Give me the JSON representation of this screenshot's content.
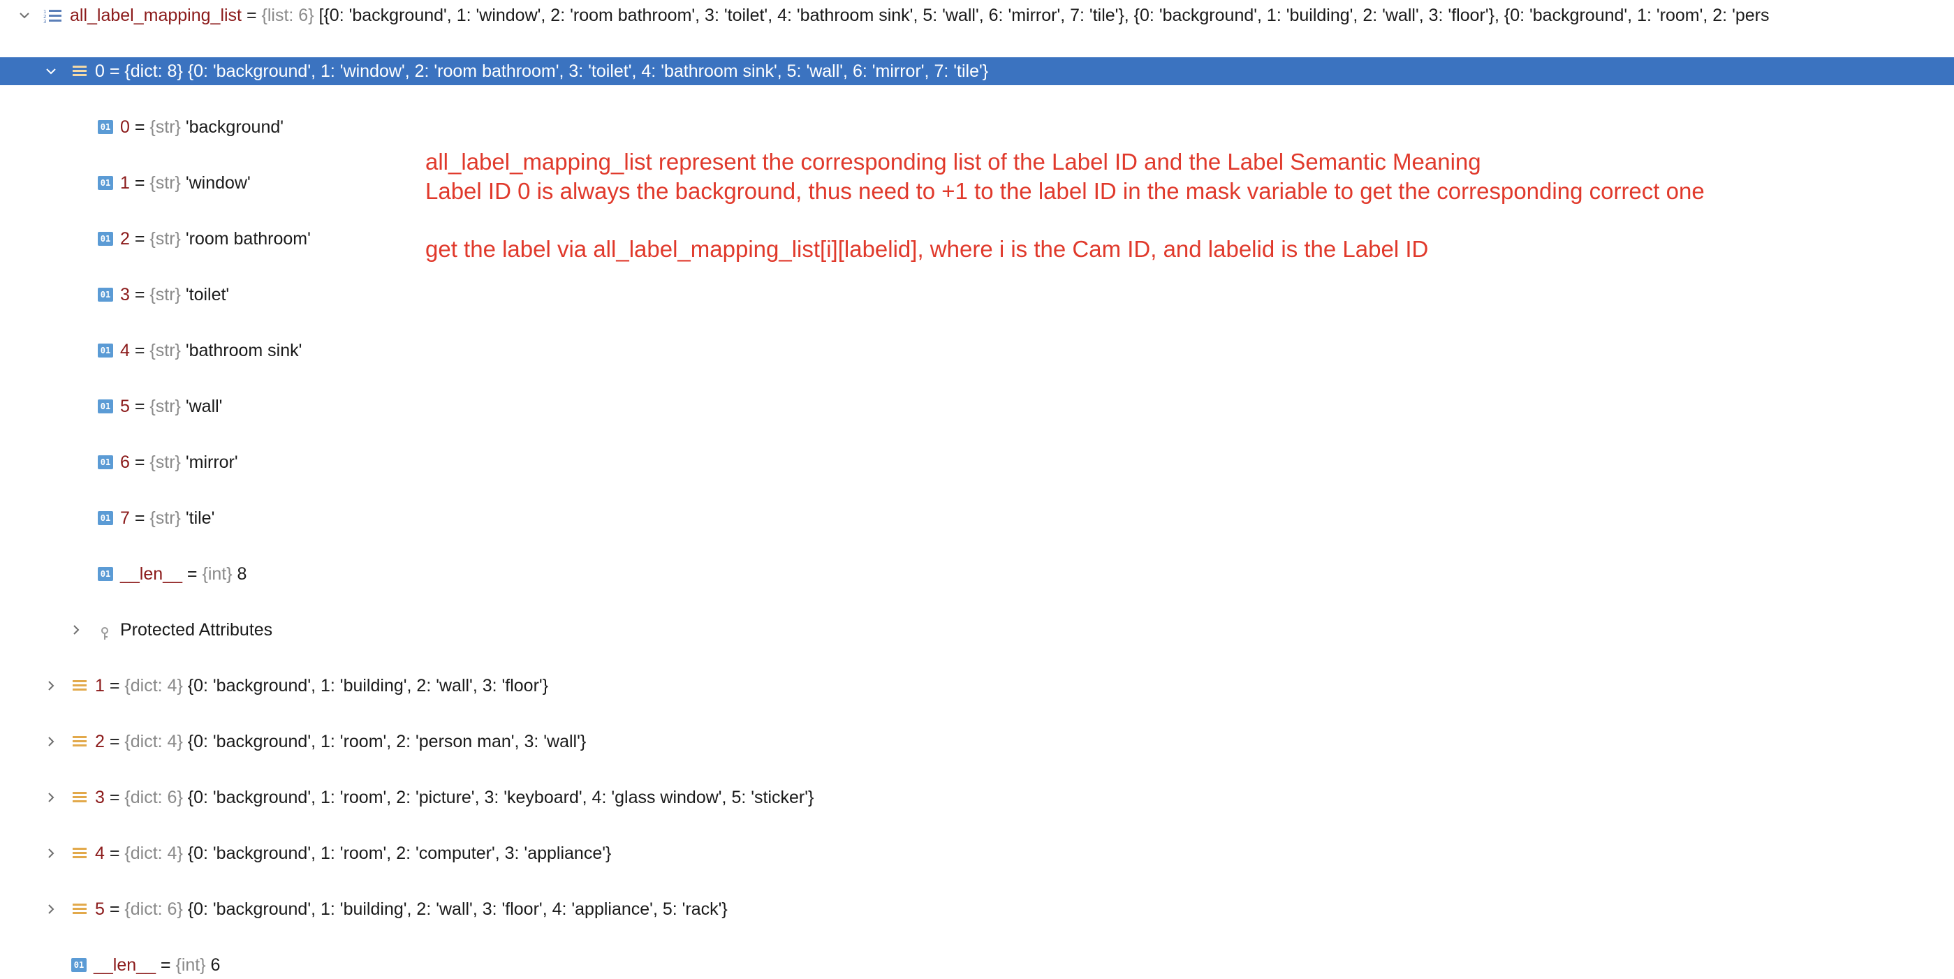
{
  "root": {
    "name": "all_label_mapping_list",
    "eq": " = ",
    "type": "{list: 6}",
    "value": "[{0: 'background', 1: 'window', 2: 'room bathroom', 3: 'toilet', 4: 'bathroom sink', 5: 'wall', 6: 'mirror', 7: 'tile'}, {0: 'background', 1: 'building', 2: 'wall', 3: 'floor'}, {0: 'background', 1: 'room', 2: 'pers"
  },
  "item0": {
    "name": "0",
    "eq": " = ",
    "type": "{dict: 8}",
    "value": "{0: 'background', 1: 'window', 2: 'room bathroom', 3: 'toilet', 4: 'bathroom sink', 5: 'wall', 6: 'mirror', 7: 'tile'}",
    "entries": [
      {
        "name": "0",
        "eq": " = ",
        "type": "{str}",
        "value": "'background'",
        "icon_label": "01"
      },
      {
        "name": "1",
        "eq": " = ",
        "type": "{str}",
        "value": "'window'",
        "icon_label": "01"
      },
      {
        "name": "2",
        "eq": " = ",
        "type": "{str}",
        "value": "'room bathroom'",
        "icon_label": "01"
      },
      {
        "name": "3",
        "eq": " = ",
        "type": "{str}",
        "value": "'toilet'",
        "icon_label": "01"
      },
      {
        "name": "4",
        "eq": " = ",
        "type": "{str}",
        "value": "'bathroom sink'",
        "icon_label": "01"
      },
      {
        "name": "5",
        "eq": " = ",
        "type": "{str}",
        "value": "'wall'",
        "icon_label": "01"
      },
      {
        "name": "6",
        "eq": " = ",
        "type": "{str}",
        "value": "'mirror'",
        "icon_label": "01"
      },
      {
        "name": "7",
        "eq": " = ",
        "type": "{str}",
        "value": "'tile'",
        "icon_label": "01"
      },
      {
        "name": "__len__",
        "eq": " = ",
        "type": "{int}",
        "value": "8",
        "icon_label": "01"
      }
    ],
    "protected": "Protected Attributes"
  },
  "items": [
    {
      "name": "1",
      "eq": " = ",
      "type": "{dict: 4}",
      "value": "{0: 'background', 1: 'building', 2: 'wall', 3: 'floor'}"
    },
    {
      "name": "2",
      "eq": " = ",
      "type": "{dict: 4}",
      "value": "{0: 'background', 1: 'room', 2: 'person man', 3: 'wall'}"
    },
    {
      "name": "3",
      "eq": " = ",
      "type": "{dict: 6}",
      "value": "{0: 'background', 1: 'room', 2: 'picture', 3: 'keyboard', 4: 'glass window', 5: 'sticker'}"
    },
    {
      "name": "4",
      "eq": " = ",
      "type": "{dict: 4}",
      "value": "{0: 'background', 1: 'room', 2: 'computer', 3: 'appliance'}"
    },
    {
      "name": "5",
      "eq": " = ",
      "type": "{dict: 6}",
      "value": "{0: 'background', 1: 'building', 2: 'wall', 3: 'floor', 4: 'appliance', 5: 'rack'}"
    }
  ],
  "root_len": {
    "name": "__len__",
    "eq": " = ",
    "type": "{int}",
    "value": "6",
    "icon_label": "01"
  },
  "annotations": {
    "line1": "all_label_mapping_list represent the corresponding list of the Label ID and the Label Semantic Meaning",
    "line2": "Label ID 0 is always the background, thus need to +1 to the label ID in the mask variable to get the corresponding correct one",
    "line3": "get the label via all_label_mapping_list[i][labelid], where i is the Cam ID, and labelid is the Label ID"
  },
  "icons": {
    "expanded": "chevron-down-icon",
    "collapsed": "chevron-right-icon",
    "list": "list-icon",
    "dict": "dict-icon",
    "value": "str-value-icon",
    "protected": "key-icon"
  },
  "colors": {
    "selection": "#3b73c0",
    "variable_name": "#8b1a1a",
    "type_label": "#8a8a8a",
    "annotation": "#e0392b",
    "dict_icon": "#e2a94b",
    "value_icon": "#5b9bd5"
  }
}
